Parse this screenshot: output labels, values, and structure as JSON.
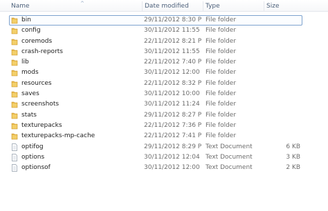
{
  "columns": {
    "name": "Name",
    "date_modified": "Date modified",
    "type": "Type",
    "size": "Size"
  },
  "colors": {
    "folder": "#e8b94a",
    "selection_border": "#7da2ce",
    "header_text": "#4c607a"
  },
  "files": [
    {
      "name": "bin",
      "date": "29/11/2012 8:30 PM",
      "type": "File folder",
      "size": "",
      "icon": "folder-icon",
      "selected": true
    },
    {
      "name": "config",
      "date": "30/11/2012 11:55 ...",
      "type": "File folder",
      "size": "",
      "icon": "folder-icon"
    },
    {
      "name": "coremods",
      "date": "22/11/2012 8:21 PM",
      "type": "File folder",
      "size": "",
      "icon": "folder-icon"
    },
    {
      "name": "crash-reports",
      "date": "30/11/2012 11:55 ...",
      "type": "File folder",
      "size": "",
      "icon": "folder-icon"
    },
    {
      "name": "lib",
      "date": "22/11/2012 7:40 PM",
      "type": "File folder",
      "size": "",
      "icon": "folder-icon"
    },
    {
      "name": "mods",
      "date": "30/11/2012 12:00 ...",
      "type": "File folder",
      "size": "",
      "icon": "folder-icon"
    },
    {
      "name": "resources",
      "date": "22/11/2012 8:32 PM",
      "type": "File folder",
      "size": "",
      "icon": "folder-icon"
    },
    {
      "name": "saves",
      "date": "30/11/2012 10:00 ...",
      "type": "File folder",
      "size": "",
      "icon": "folder-icon"
    },
    {
      "name": "screenshots",
      "date": "30/11/2012 11:24 ...",
      "type": "File folder",
      "size": "",
      "icon": "folder-icon"
    },
    {
      "name": "stats",
      "date": "29/11/2012 8:27 PM",
      "type": "File folder",
      "size": "",
      "icon": "folder-icon"
    },
    {
      "name": "texturepacks",
      "date": "22/11/2012 7:36 PM",
      "type": "File folder",
      "size": "",
      "icon": "folder-icon"
    },
    {
      "name": "texturepacks-mp-cache",
      "date": "22/11/2012 7:41 PM",
      "type": "File folder",
      "size": "",
      "icon": "folder-icon"
    },
    {
      "name": "optifog",
      "date": "29/11/2012 8:29 PM",
      "type": "Text Document",
      "size": "6 KB",
      "icon": "text-document-icon"
    },
    {
      "name": "options",
      "date": "30/11/2012 12:04 ...",
      "type": "Text Document",
      "size": "3 KB",
      "icon": "text-document-icon"
    },
    {
      "name": "optionsof",
      "date": "30/11/2012 12:00 ...",
      "type": "Text Document",
      "size": "2 KB",
      "icon": "text-document-icon"
    }
  ]
}
